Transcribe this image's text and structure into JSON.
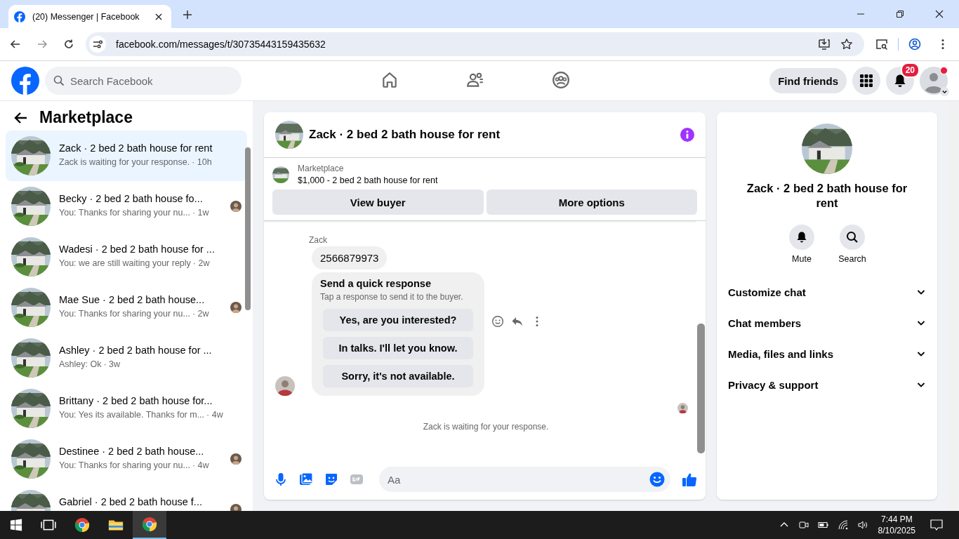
{
  "browser": {
    "tab_title": "(20) Messenger | Facebook",
    "url": "facebook.com/messages/t/30735443159435632"
  },
  "header": {
    "search_placeholder": "Search Facebook",
    "find_friends": "Find friends",
    "notification_count": "20"
  },
  "sidebar": {
    "title": "Marketplace",
    "conversations": [
      {
        "title": "Zack · 2 bed 2 bath house for rent",
        "preview": "Zack is waiting for your response.",
        "time": "· 10h",
        "selected": true,
        "seen_avatar": false
      },
      {
        "title": "Becky · 2 bed 2 bath house fo...",
        "preview": "You: Thanks for sharing your nu...",
        "time": "· 1w",
        "selected": false,
        "seen_avatar": true
      },
      {
        "title": "Wadesi · 2 bed 2 bath house for ...",
        "preview": "You: we are still waiting your reply",
        "time": "· 2w",
        "selected": false,
        "seen_avatar": false
      },
      {
        "title": "Mae Sue · 2 bed 2 bath house...",
        "preview": "You: Thanks for sharing your nu...",
        "time": "· 2w",
        "selected": false,
        "seen_avatar": true
      },
      {
        "title": "Ashley · 2 bed 2 bath house for ...",
        "preview": "Ashley: Ok",
        "time": "· 3w",
        "selected": false,
        "seen_avatar": false
      },
      {
        "title": "Brittany · 2 bed 2 bath house for...",
        "preview": "You: Yes its available. Thanks for m...",
        "time": "· 4w",
        "selected": false,
        "seen_avatar": false
      },
      {
        "title": "Destinee · 2 bed 2 bath house...",
        "preview": "You: Thanks for sharing your nu...",
        "time": "· 4w",
        "selected": false,
        "seen_avatar": true
      },
      {
        "title": "Gabriel · 2 bed 2 bath house f...",
        "selected": false,
        "seen_avatar": true
      }
    ]
  },
  "chat": {
    "title": "Zack · 2 bed 2 bath house for rent",
    "listing_label": "Marketplace",
    "listing_text": "$1,000 - 2 bed 2 bath house for rent",
    "buttons": [
      "View buyer",
      "More options"
    ],
    "sender": "Zack",
    "message": "2566879973",
    "quick_response": {
      "title": "Send a quick response",
      "hint": "Tap a response to send it to the buyer.",
      "options": [
        "Yes, are you interested?",
        "In talks. I'll let you know.",
        "Sorry, it's not available."
      ]
    },
    "status": "Zack is waiting for your response.",
    "composer_placeholder": "Aa"
  },
  "info": {
    "name": "Zack · 2 bed 2 bath house for rent",
    "actions": [
      {
        "kind": "mute",
        "label": "Mute"
      },
      {
        "kind": "search",
        "label": "Search"
      }
    ],
    "sections": [
      "Customize chat",
      "Chat members",
      "Media, files and links",
      "Privacy & support"
    ]
  },
  "taskbar": {
    "time": "7:44 PM",
    "date": "8/10/2025"
  }
}
